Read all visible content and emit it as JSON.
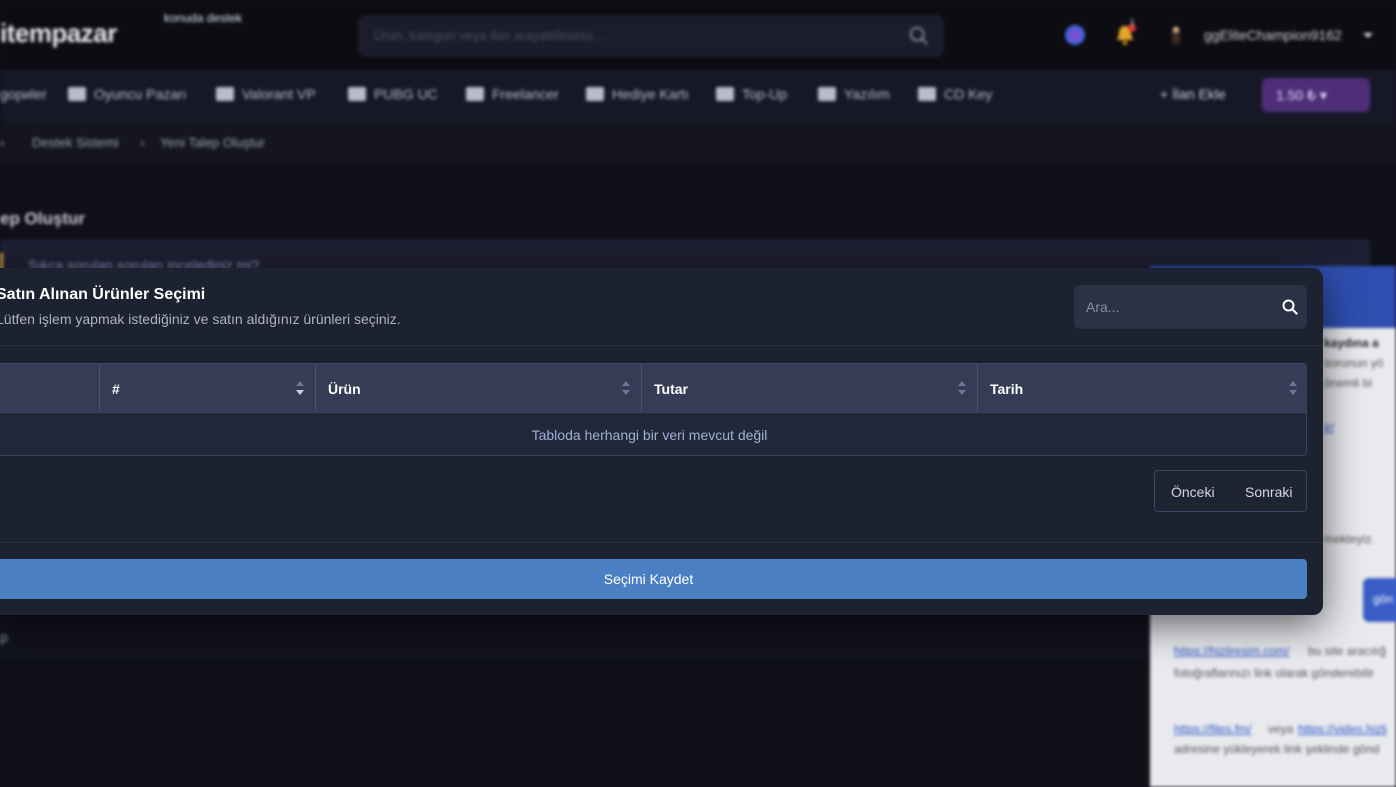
{
  "header": {
    "logo": "itempazar",
    "search_placeholder": "Ürün, kategori veya ilan arayabilirsiniz...",
    "username": "ggEliteChampion9162",
    "notification_count": "1"
  },
  "nav": {
    "items": [
      {
        "label": "gориler",
        "icon": "grid-icon"
      },
      {
        "label": "Oyuncu Pazarı",
        "icon": "store-icon"
      },
      {
        "label": "Valorant VP",
        "icon": "valorant-icon"
      },
      {
        "label": "PUBG UC",
        "icon": "helmet-icon"
      },
      {
        "label": "Freelancer",
        "icon": "briefcase-icon"
      },
      {
        "label": "Hediye Kartı",
        "icon": "gift-icon"
      },
      {
        "label": "Top-Up",
        "icon": "cart-icon"
      },
      {
        "label": "Yazılım",
        "icon": "laptop-icon"
      },
      {
        "label": "CD Key",
        "icon": "key-icon"
      }
    ],
    "add_listing": "İlan Ekle",
    "balance": "1.50 ₺"
  },
  "breadcrumb": {
    "items": [
      "Destek Sistemi",
      "Yeni Talep Oluştur"
    ]
  },
  "page": {
    "title": "ep Oluştur",
    "faq_notice": "Sıkça sorulan soruları incelediniz mi?",
    "lower_label": "p"
  },
  "side_panel": {
    "line1": "kaydına a",
    "line2": "sorunun yö",
    "line3": "önemli bi",
    "link1": "ir/",
    "blue_text": "konuda destek",
    "line4": "mekteyiz.",
    "button": "gön",
    "link2": "https://hizliresim.com/",
    "text2": "bu site aracılığ",
    "text3": "fotoğraflarınızı link olarak gönderebilir",
    "link3": "https://files.fm/",
    "text4": "veya",
    "link4": "https://video.hizli",
    "text5": "adresine yükleyerek link şeklinde gönd"
  },
  "modal": {
    "title": "Satın Alınan Ürünler Seçimi",
    "subtitle": "Lütfen işlem yapmak istediğiniz ve satın aldığınız ürünleri seçiniz.",
    "search_placeholder": "Ara...",
    "columns": [
      "",
      "#",
      "Ürün",
      "Tutar",
      "Tarih"
    ],
    "empty_message": "Tabloda herhangi bir veri mevcut değil",
    "prev_label": "Önceki",
    "next_label": "Sonraki",
    "save_label": "Seçimi Kaydet"
  },
  "colors": {
    "modal_bg": "#1d2230",
    "table_header": "#343d55",
    "primary_button": "#4a80c1",
    "balance_bg": "#4d2e77"
  }
}
